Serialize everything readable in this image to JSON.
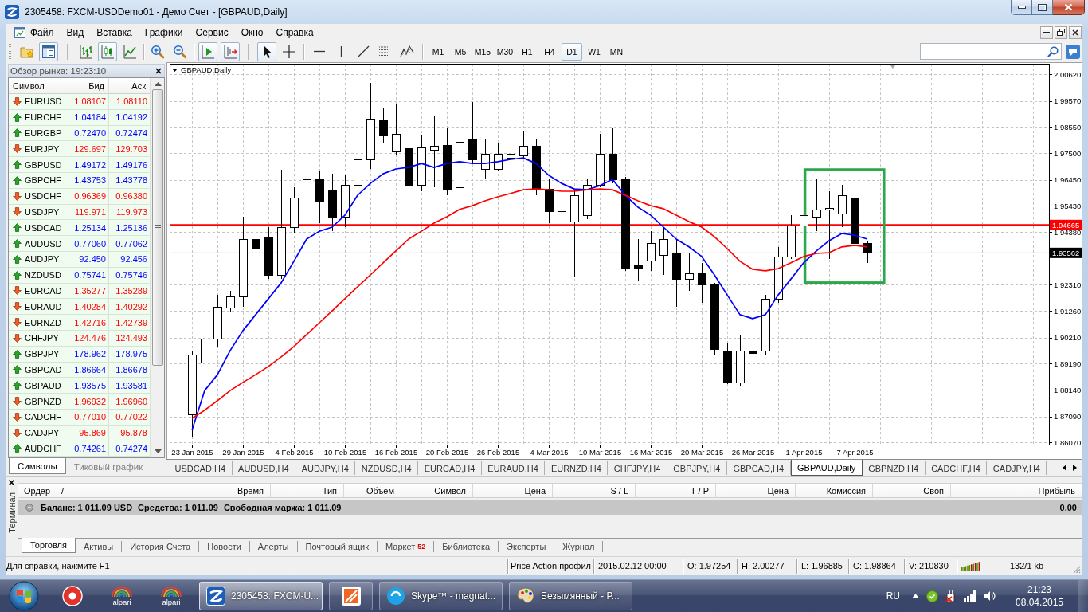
{
  "window": {
    "title": "2305458: FXCM-USDDemo01 - Демо Счет - [GBPAUD,Daily]"
  },
  "menu": [
    "Файл",
    "Вид",
    "Вставка",
    "Графики",
    "Сервис",
    "Окно",
    "Справка"
  ],
  "toolbar": {
    "tool_groups": [
      [
        {
          "kind": "profiles",
          "pressed": false
        },
        {
          "kind": "navigator",
          "pressed": true
        }
      ],
      [
        {
          "kind": "bars",
          "pressed": false
        },
        {
          "kind": "candles",
          "pressed": true
        },
        {
          "kind": "line",
          "pressed": false
        }
      ],
      [
        {
          "kind": "zoomin",
          "pressed": false
        },
        {
          "kind": "zoomout",
          "pressed": false
        }
      ],
      [
        {
          "kind": "autoscroll",
          "pressed": true
        },
        {
          "kind": "shift",
          "pressed": true
        }
      ],
      [
        {
          "kind": "cursor",
          "pressed": true
        },
        {
          "kind": "crosshair",
          "pressed": false
        }
      ],
      [
        {
          "kind": "hline",
          "pressed": false
        },
        {
          "kind": "vline",
          "pressed": false
        },
        {
          "kind": "trendline",
          "pressed": false
        },
        {
          "kind": "fibonacci",
          "pressed": false
        },
        {
          "kind": "elliott",
          "pressed": false
        }
      ]
    ],
    "timeframes": [
      {
        "label": "M1",
        "selected": false
      },
      {
        "label": "M5",
        "selected": false
      },
      {
        "label": "M15",
        "selected": false
      },
      {
        "label": "M30",
        "selected": false
      },
      {
        "label": "H1",
        "selected": false
      },
      {
        "label": "H4",
        "selected": false
      },
      {
        "label": "D1",
        "selected": true
      },
      {
        "label": "W1",
        "selected": false
      },
      {
        "label": "MN",
        "selected": false
      }
    ]
  },
  "market_watch": {
    "title": "Обзор рынка: 19:23:10",
    "columns": [
      "Символ",
      "Бид",
      "Аск"
    ],
    "rows": [
      {
        "symbol": "EURUSD",
        "bid": "1.08107",
        "ask": "1.08110",
        "rising": false
      },
      {
        "symbol": "EURCHF",
        "bid": "1.04184",
        "ask": "1.04192",
        "rising": true
      },
      {
        "symbol": "EURGBP",
        "bid": "0.72470",
        "ask": "0.72474",
        "rising": true
      },
      {
        "symbol": "EURJPY",
        "bid": "129.697",
        "ask": "129.703",
        "rising": false
      },
      {
        "symbol": "GBPUSD",
        "bid": "1.49172",
        "ask": "1.49176",
        "rising": true
      },
      {
        "symbol": "GBPCHF",
        "bid": "1.43753",
        "ask": "1.43778",
        "rising": true
      },
      {
        "symbol": "USDCHF",
        "bid": "0.96369",
        "ask": "0.96380",
        "rising": false
      },
      {
        "symbol": "USDJPY",
        "bid": "119.971",
        "ask": "119.973",
        "rising": false
      },
      {
        "symbol": "USDCAD",
        "bid": "1.25134",
        "ask": "1.25136",
        "rising": true
      },
      {
        "symbol": "AUDUSD",
        "bid": "0.77060",
        "ask": "0.77062",
        "rising": true
      },
      {
        "symbol": "AUDJPY",
        "bid": "92.450",
        "ask": "92.456",
        "rising": true
      },
      {
        "symbol": "NZDUSD",
        "bid": "0.75741",
        "ask": "0.75746",
        "rising": true
      },
      {
        "symbol": "EURCAD",
        "bid": "1.35277",
        "ask": "1.35289",
        "rising": false
      },
      {
        "symbol": "EURAUD",
        "bid": "1.40284",
        "ask": "1.40292",
        "rising": false
      },
      {
        "symbol": "EURNZD",
        "bid": "1.42716",
        "ask": "1.42739",
        "rising": false
      },
      {
        "symbol": "CHFJPY",
        "bid": "124.476",
        "ask": "124.493",
        "rising": false
      },
      {
        "symbol": "GBPJPY",
        "bid": "178.962",
        "ask": "178.975",
        "rising": true
      },
      {
        "symbol": "GBPCAD",
        "bid": "1.86664",
        "ask": "1.86678",
        "rising": true
      },
      {
        "symbol": "GBPAUD",
        "bid": "1.93575",
        "ask": "1.93581",
        "rising": true
      },
      {
        "symbol": "GBPNZD",
        "bid": "1.96932",
        "ask": "1.96960",
        "rising": false
      },
      {
        "symbol": "CADCHF",
        "bid": "0.77010",
        "ask": "0.77022",
        "rising": false
      },
      {
        "symbol": "CADJPY",
        "bid": "95.869",
        "ask": "95.878",
        "rising": false
      },
      {
        "symbol": "AUDCHF",
        "bid": "0.74261",
        "ask": "0.74274",
        "rising": true
      }
    ],
    "tabs": [
      {
        "label": "Символы",
        "selected": true
      },
      {
        "label": "Тиковый график",
        "selected": false
      }
    ]
  },
  "chart": {
    "chart_data": {
      "type": "candlestick",
      "title": "GBPAUD,Daily",
      "categories": [
        "23 Jan 2015",
        null,
        null,
        null,
        "29 Jan 2015",
        null,
        null,
        null,
        "4 Feb 2015",
        null,
        null,
        null,
        "10 Feb 2015",
        null,
        null,
        null,
        "16 Feb 2015",
        null,
        null,
        null,
        "20 Feb 2015",
        null,
        null,
        null,
        "26 Feb 2015",
        null,
        null,
        null,
        "4 Mar 2015",
        null,
        null,
        null,
        "10 Mar 2015",
        null,
        null,
        null,
        "16 Mar 2015",
        null,
        null,
        null,
        "20 Mar 2015",
        null,
        null,
        null,
        "26 Mar 2015",
        null,
        null,
        null,
        "1 Apr 2015",
        null,
        null,
        null,
        "7 Apr 2015",
        null
      ],
      "ylim": [
        1.8598,
        2.0104
      ],
      "yticks": [
        {
          "value": 2.0062,
          "label": "2.00620"
        },
        {
          "value": 1.9957,
          "label": "1.99570"
        },
        {
          "value": 1.9855,
          "label": "1.98550"
        },
        {
          "value": 1.975,
          "label": "1.97500"
        },
        {
          "value": 1.9645,
          "label": "1.96450"
        },
        {
          "value": 1.9543,
          "label": "1.95430"
        },
        {
          "value": 1.9438,
          "label": "1.94380"
        },
        {
          "value": 1.9231,
          "label": "1.92310"
        },
        {
          "value": 1.9126,
          "label": "1.91260"
        },
        {
          "value": 1.9021,
          "label": "1.90210"
        },
        {
          "value": 1.8919,
          "label": "1.89190"
        },
        {
          "value": 1.8814,
          "label": "1.88140"
        },
        {
          "value": 1.8709,
          "label": "1.87090"
        },
        {
          "value": 1.8607,
          "label": "1.86070"
        }
      ],
      "grid": true,
      "series": [
        {
          "type": "candlestick",
          "ohlc": [
            [
              1.8718,
              1.897,
              1.863,
              1.8954
            ],
            [
              1.8923,
              1.9064,
              1.8875,
              1.9017
            ],
            [
              1.9017,
              1.919,
              1.8986,
              1.9143
            ],
            [
              1.914,
              1.9206,
              1.9121,
              1.9184
            ],
            [
              1.9184,
              1.9499,
              1.9143,
              1.9411
            ],
            [
              1.9411,
              1.949,
              1.9342,
              1.9373
            ],
            [
              1.942,
              1.9458,
              1.9253,
              1.9269
            ],
            [
              1.9269,
              1.9685,
              1.9253,
              1.9458
            ],
            [
              1.9458,
              1.9616,
              1.9436,
              1.9575
            ],
            [
              1.9575,
              1.9679,
              1.9521,
              1.9647
            ],
            [
              1.9647,
              1.9679,
              1.9474,
              1.9559
            ],
            [
              1.9606,
              1.9669,
              1.9442,
              1.9499
            ],
            [
              1.9499,
              1.9663,
              1.9458,
              1.9625
            ],
            [
              1.9625,
              1.9757,
              1.96,
              1.9726
            ],
            [
              1.97254,
              2.00277,
              1.96885,
              1.98864
            ],
            [
              1.9883,
              1.9931,
              1.9789,
              1.982
            ],
            [
              1.9757,
              1.9946,
              1.9742,
              1.9827
            ],
            [
              1.977,
              1.982,
              1.9606,
              1.9625
            ],
            [
              1.9625,
              1.982,
              1.96,
              1.9773
            ],
            [
              1.9764,
              1.9899,
              1.9616,
              1.978
            ],
            [
              1.9783,
              1.9852,
              1.9584,
              1.9609
            ],
            [
              1.9616,
              1.9852,
              1.9578,
              1.9795
            ],
            [
              1.9805,
              1.9953,
              1.971,
              1.9726
            ],
            [
              1.9688,
              1.9805,
              1.9647,
              1.9748
            ],
            [
              1.9688,
              1.9789,
              1.9679,
              1.9748
            ],
            [
              1.9732,
              1.982,
              1.9694,
              1.9748
            ],
            [
              1.9742,
              1.9836,
              1.9726,
              1.978
            ],
            [
              1.978,
              1.9805,
              1.9584,
              1.9606
            ],
            [
              1.9609,
              1.9647,
              1.9474,
              1.9521
            ],
            [
              1.9521,
              1.9616,
              1.9458,
              1.9575
            ],
            [
              1.948,
              1.9609,
              1.9263,
              1.9584
            ],
            [
              1.9505,
              1.9647,
              1.949,
              1.9625
            ],
            [
              1.9625,
              1.9827,
              1.9616,
              1.9748
            ],
            [
              1.9748,
              1.9852,
              1.9631,
              1.9647
            ],
            [
              1.9647,
              1.9657,
              1.9285,
              1.9294
            ],
            [
              1.9307,
              1.9411,
              1.9247,
              1.9294
            ],
            [
              1.9326,
              1.9442,
              1.9285,
              1.9395
            ],
            [
              1.9348,
              1.9458,
              1.9269,
              1.9411
            ],
            [
              1.9354,
              1.9411,
              1.9143,
              1.9253
            ],
            [
              1.9253,
              1.9354,
              1.9206,
              1.9276
            ],
            [
              1.9276,
              1.9317,
              1.9159,
              1.9231
            ],
            [
              1.9231,
              1.9237,
              1.8954,
              1.8976
            ],
            [
              1.897,
              1.9001,
              1.8838,
              1.8844
            ],
            [
              1.8844,
              1.9033,
              1.8828,
              1.897
            ],
            [
              1.897,
              1.9064,
              1.8891,
              1.8961
            ],
            [
              1.897,
              1.919,
              1.8954,
              1.9175
            ],
            [
              1.9175,
              1.938,
              1.9159,
              1.9342
            ],
            [
              1.9342,
              1.9505,
              1.9332,
              1.9465
            ],
            [
              1.9465,
              1.9521,
              1.9426,
              1.9505
            ],
            [
              1.9499,
              1.9647,
              1.9442,
              1.9528
            ],
            [
              1.9528,
              1.96,
              1.9332,
              1.9534
            ],
            [
              1.9512,
              1.9625,
              1.9458,
              1.9584
            ],
            [
              1.9575,
              1.9638,
              1.9354,
              1.9395
            ],
            [
              1.9395,
              1.9401,
              1.9317,
              1.93562
            ]
          ]
        },
        {
          "type": "line",
          "color": "#0000ff",
          "values": [
            1.8655,
            1.8812,
            1.8875,
            1.897,
            1.9049,
            1.9112,
            1.9175,
            1.9238,
            1.9323,
            1.9411,
            1.9442,
            1.9458,
            1.9505,
            1.9584,
            1.9631,
            1.9669,
            1.9688,
            1.9694,
            1.971,
            1.9694,
            1.971,
            1.9717,
            1.971,
            1.971,
            1.9717,
            1.9726,
            1.9732,
            1.971,
            1.9663,
            1.9631,
            1.9609,
            1.9606,
            1.9622,
            1.9647,
            1.9584,
            1.9537,
            1.9505,
            1.9458,
            1.9411,
            1.938,
            1.9342,
            1.9269,
            1.919,
            1.9112,
            1.9096,
            1.9112,
            1.919,
            1.9253,
            1.9317,
            1.9364,
            1.9405,
            1.9433,
            1.9426,
            1.9411
          ]
        },
        {
          "type": "line",
          "color": "#ff0000",
          "values": [
            1.8702,
            1.8734,
            1.8772,
            1.8812,
            1.8844,
            1.8875,
            1.8907,
            1.8945,
            1.8986,
            1.9033,
            1.908,
            1.9127,
            1.9175,
            1.9222,
            1.9269,
            1.9317,
            1.9364,
            1.9411,
            1.9442,
            1.9474,
            1.9499,
            1.9528,
            1.9543,
            1.9562,
            1.9578,
            1.9591,
            1.9606,
            1.9609,
            1.9606,
            1.96,
            1.96,
            1.9606,
            1.9609,
            1.9606,
            1.9584,
            1.9562,
            1.9543,
            1.9531,
            1.9505,
            1.948,
            1.9458,
            1.942,
            1.9373,
            1.9323,
            1.9291,
            1.9285,
            1.9294,
            1.9317,
            1.9342,
            1.9354,
            1.9357,
            1.938,
            1.9386,
            1.938
          ]
        }
      ],
      "ref_lines": [
        {
          "axis": "y",
          "value": 1.94665,
          "label": "1.94665",
          "color": "#ff0000",
          "line_style": "solid"
        },
        {
          "axis": "y",
          "value": 1.93562,
          "label": "1.93562",
          "color": "#c0c0c0",
          "line_style": "solid"
        }
      ]
    }
  },
  "chart_tabs": [
    {
      "label": "USDCAD,H4",
      "selected": false
    },
    {
      "label": "AUDUSD,H4",
      "selected": false
    },
    {
      "label": "AUDJPY,H4",
      "selected": false
    },
    {
      "label": "NZDUSD,H4",
      "selected": false
    },
    {
      "label": "EURCAD,H4",
      "selected": false
    },
    {
      "label": "EURAUD,H4",
      "selected": false
    },
    {
      "label": "EURNZD,H4",
      "selected": false
    },
    {
      "label": "CHFJPY,H4",
      "selected": false
    },
    {
      "label": "GBPJPY,H4",
      "selected": false
    },
    {
      "label": "GBPCAD,H4",
      "selected": false
    },
    {
      "label": "GBPAUD,Daily",
      "selected": true
    },
    {
      "label": "GBPNZD,H4",
      "selected": false
    },
    {
      "label": "CADCHF,H4",
      "selected": false
    },
    {
      "label": "CADJPY,H4",
      "selected": false
    }
  ],
  "terminal": {
    "title": "Терминал",
    "columns": [
      "Ордер",
      "Время",
      "Тип",
      "Объем",
      "Символ",
      "Цена",
      "S / L",
      "T / P",
      "Цена",
      "Комиссия",
      "Своп",
      "Прибыль"
    ],
    "sort_indicator": "/",
    "balance_row": {
      "balance": "Баланс: 1 011.09 USD",
      "equity": "Средства: 1 011.09",
      "free_margin": "Свободная маржа: 1 011.09",
      "profit": "0.00"
    },
    "tabs": [
      {
        "label": "Торговля",
        "selected": true
      },
      {
        "label": "Активы",
        "selected": false
      },
      {
        "label": "История Счета",
        "selected": false
      },
      {
        "label": "Новости",
        "selected": false
      },
      {
        "label": "Алерты",
        "selected": false
      },
      {
        "label": "Почтовый ящик",
        "selected": false
      },
      {
        "label": "Маркет",
        "badge": "52",
        "selected": false
      },
      {
        "label": "Библиотека",
        "selected": false
      },
      {
        "label": "Эксперты",
        "selected": false
      },
      {
        "label": "Журнал",
        "selected": false
      }
    ]
  },
  "status_bar": {
    "help": "Для справки, нажмите F1",
    "profile": "Price Action профил",
    "datetime": "2015.02.12 00:00",
    "open": "O: 1.97254",
    "high": "H: 2.00277",
    "low": "L: 1.96885",
    "close": "C: 1.98864",
    "volume": "V: 210830",
    "traffic": "132/1 kb"
  },
  "taskbar": {
    "apps": [
      {
        "kind": "browser",
        "selected": false
      },
      {
        "kind": "broker",
        "label": "alpari",
        "selected": false
      },
      {
        "kind": "broker",
        "label": "alpari",
        "selected": false
      },
      {
        "kind": "terminal",
        "label": "2305458: FXCM-U...",
        "selected": true
      },
      {
        "kind": "launcher",
        "selected": false
      },
      {
        "kind": "messenger",
        "label": "Skype™ - magnat...",
        "selected": false
      },
      {
        "kind": "paint",
        "label": "Безымянный - P...",
        "selected": false
      }
    ],
    "language": "RU",
    "time": "21:23",
    "date": "08.04.2015"
  }
}
